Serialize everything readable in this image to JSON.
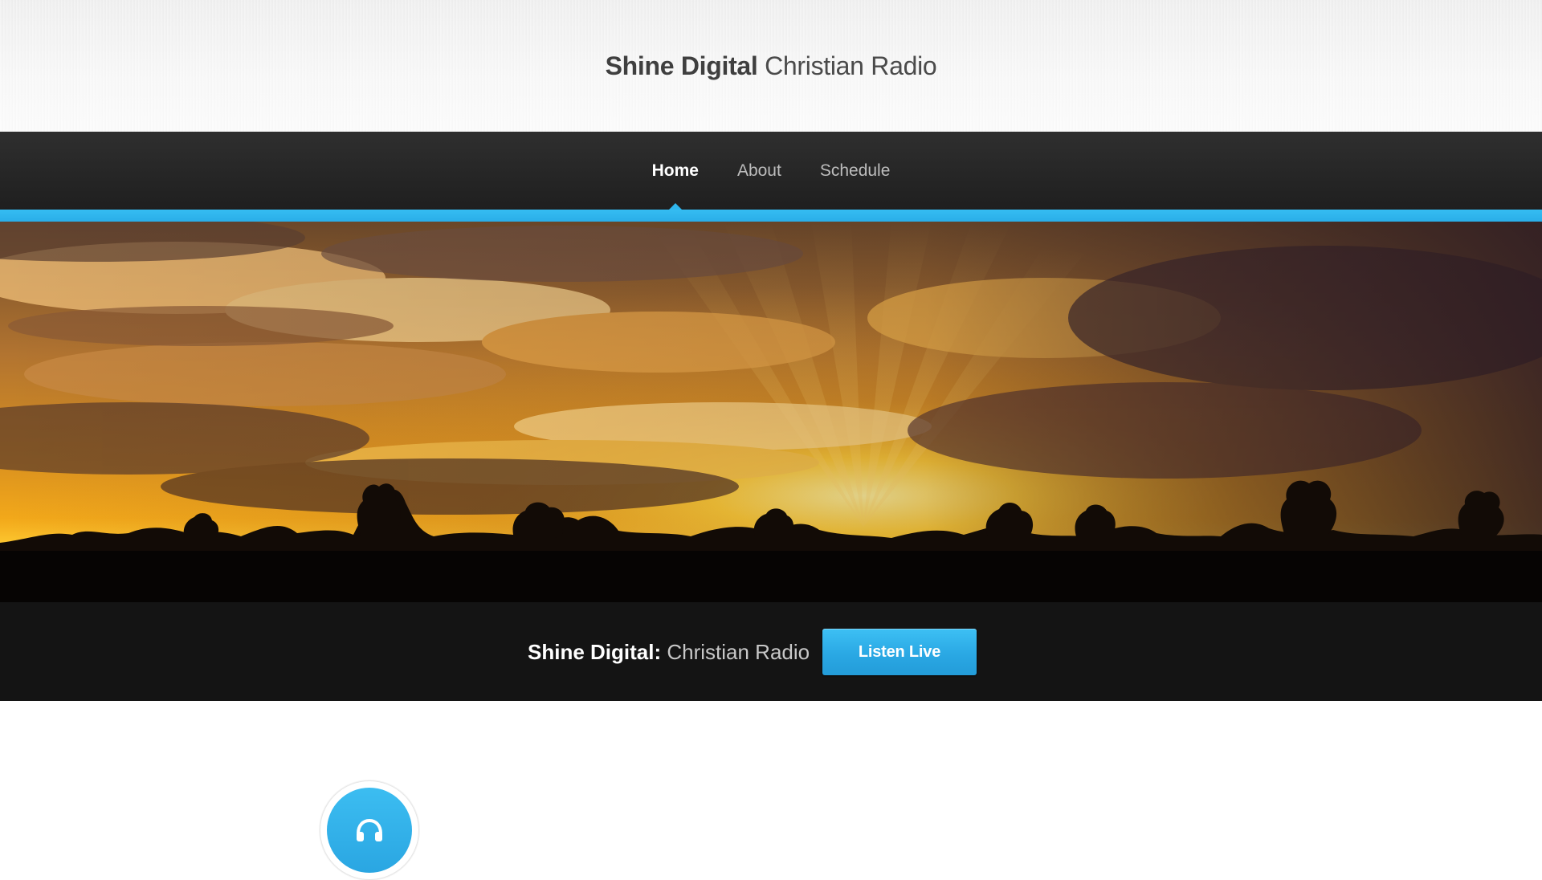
{
  "header": {
    "title_strong": "Shine Digital",
    "title_light": "Christian Radio"
  },
  "nav": {
    "items": [
      {
        "label": "Home",
        "active": true
      },
      {
        "label": "About",
        "active": false
      },
      {
        "label": "Schedule",
        "active": false
      }
    ]
  },
  "hero": {
    "image": "sunset-over-trees"
  },
  "cta": {
    "text_strong": "Shine Digital:",
    "text_light": "Christian Radio",
    "button_label": "Listen Live"
  },
  "feature": {
    "icon": "headphones-icon"
  },
  "colors": {
    "accent": "#2fb5ec",
    "nav_bg": "#262626",
    "cta_bg": "#141414",
    "header_bg": "#f5f5f5"
  }
}
